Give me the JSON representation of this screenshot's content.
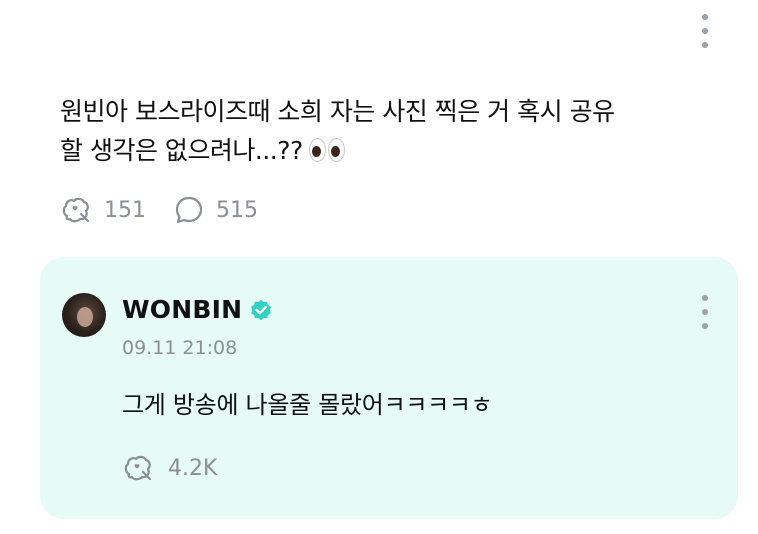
{
  "post": {
    "text_line1": "원빈아 보스라이즈때 소희 자는 사진 찍은 거 혹시 공유",
    "text_line2": "할 생각은 없으려나...??",
    "emoji_icon": "eyes-icon",
    "like_count": "151",
    "comment_count": "515"
  },
  "reply": {
    "author": "WONBIN",
    "verified": true,
    "timestamp": "09.11 21:08",
    "text": "그게 방송에 나올줄 몰랐어ㅋㅋㅋㅋㅎ",
    "like_count": "4.2K"
  },
  "colors": {
    "card_background": "#e6fbf6",
    "muted_text": "#8a8f96",
    "verified_badge": "#2fd3c3"
  }
}
